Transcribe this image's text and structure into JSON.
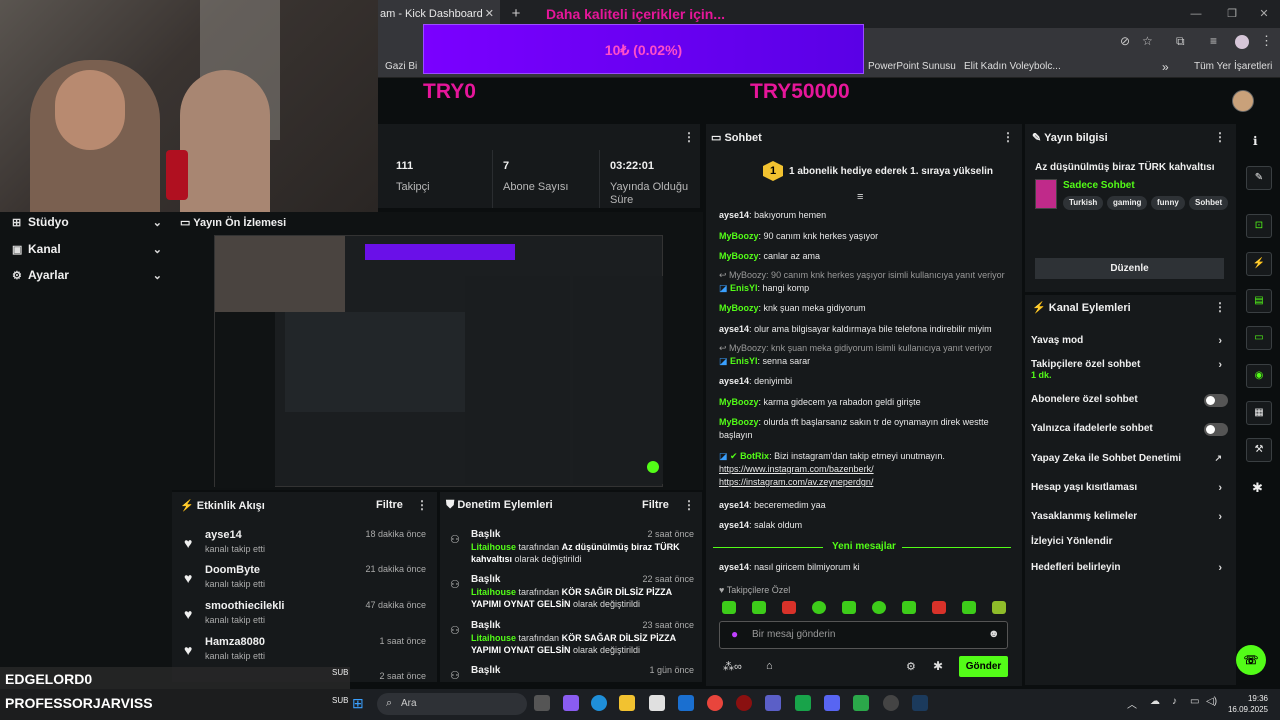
{
  "browser": {
    "tab_title": "am - Kick Dashboard",
    "tab_close": "✕",
    "new_tab": "+",
    "bookmarks": [
      "Gazi Bi",
      "PowerPoint Sunusu",
      "Elit Kadın Voleybolc...",
      "Tüm Yer İşaretleri"
    ]
  },
  "overlay": {
    "title": "Daha kaliteli içerikler için...",
    "bar_text": "10₺ (0.02%)",
    "progress_percent": 0.02,
    "left_label": "TRY0",
    "right_label": "TRY50000"
  },
  "nav": {
    "items": [
      {
        "label": "Stüdyo",
        "icon": "studio-icon"
      },
      {
        "label": "Kanal",
        "icon": "channel-icon"
      },
      {
        "label": "Ayarlar",
        "icon": "gear-icon"
      }
    ]
  },
  "stats": {
    "items": [
      {
        "value": "111",
        "label": "Takipçi"
      },
      {
        "value": "7",
        "label": "Abone Sayısı"
      },
      {
        "value": "03:22:01",
        "label": "Yayında Olduğu Süre"
      }
    ]
  },
  "preview": {
    "title": "Yayın Ön İzlemesi"
  },
  "activity": {
    "title": "Etkinlik Akışı",
    "filter": "Filtre",
    "items": [
      {
        "name": "ayse14",
        "desc": "kanalı takip etti",
        "time": "18 dakika önce"
      },
      {
        "name": "DoomByte",
        "desc": "kanalı takip etti",
        "time": "21 dakika önce"
      },
      {
        "name": "smoothiecilekli",
        "desc": "kanalı takip etti",
        "time": "47 dakika önce"
      },
      {
        "name": "Hamza8080",
        "desc": "kanalı takip etti",
        "time": "1 saat önce"
      },
      {
        "name": "",
        "desc": "",
        "time": "2 saat önce"
      }
    ]
  },
  "moderation": {
    "title": "Denetim Eylemleri",
    "filter": "Filtre",
    "items": [
      {
        "title": "Başlık",
        "time": "2 saat önce",
        "user": "Litaihouse",
        "mid": "tarafından",
        "value": "Az düşünülmüş biraz TÜRK kahvaltısı",
        "tail": "olarak değiştirildi"
      },
      {
        "title": "Başlık",
        "time": "22 saat önce",
        "user": "Litaihouse",
        "mid": "tarafından",
        "value": "KÖR SAĞIR DİLSİZ PİZZA YAPIMI OYNAT GELSİN",
        "tail": "olarak değiştirildi"
      },
      {
        "title": "Başlık",
        "time": "23 saat önce",
        "user": "Litaihouse",
        "mid": "tarafından",
        "value": "KÖR SAĞAR DİLSİZ PİZZA YAPIMI OYNAT GELSİN",
        "tail": "olarak değiştirildi"
      },
      {
        "title": "Başlık",
        "time": "1 gün önce",
        "user": "",
        "mid": "",
        "value": "",
        "tail": ""
      }
    ]
  },
  "chat": {
    "title": "Sohbet",
    "pinned": "1 abonelik hediye ederek 1. sıraya yükselin",
    "pinned_badge": "1",
    "messages": [
      {
        "user": "ayse14",
        "text": "bakıyorum hemen"
      },
      {
        "user": "MyBoozy",
        "text": "90 canım knk herkes yaşıyor"
      },
      {
        "user": "MyBoozy",
        "text": "canlar az ama"
      },
      {
        "reply": "MyBoozy: 90 canım knk herkes yaşıyor isimli kullanıcıya yanıt veriyor",
        "user": "EnisYl",
        "text": "hangi komp"
      },
      {
        "user": "MyBoozy",
        "text": "knk şuan meka gidiyorum"
      },
      {
        "user": "ayse14",
        "text": "olur ama bilgisayar kaldırmaya bile telefona indirebilir miyim"
      },
      {
        "reply": "MyBoozy: knk şuan meka gidiyorum isimli kullanıcıya yanıt veriyor",
        "user": "EnisYl",
        "text": "senna sarar"
      },
      {
        "user": "ayse14",
        "text": "deniyimbi"
      },
      {
        "user": "MyBoozy",
        "text": "karma gidecem ya rabadon geldi girişte"
      },
      {
        "user": "MyBoozy",
        "text": "olurda tft başlarsanız sakın tr de oynamayın direk westte başlayın"
      },
      {
        "user": "BotRix",
        "text": "Bizi instagram'dan takip etmeyi unutmayın.",
        "link1": "https://www.instagram.com/bazenberk/",
        "link2": "https://instagram.com/av.zeyneperdgn/"
      },
      {
        "user": "ayse14",
        "text": "beceremedim yaa"
      },
      {
        "user": "ayse14",
        "text": "salak oldum"
      },
      {
        "user": "ayse14",
        "text": "nasıl giricem bilmiyorum ki"
      }
    ],
    "new_messages": "Yeni mesajlar",
    "followers_only": "Takipçilere Özel",
    "input_placeholder": "Bir mesaj gönderin",
    "send": "Gönder"
  },
  "info": {
    "title": "Yayın bilgisi",
    "stream_title": "Az düşünülmüş biraz TÜRK kahvaltısı",
    "category": "Sadece Sohbet",
    "tags": [
      "Turkish",
      "gaming",
      "funny",
      "Sohbet"
    ],
    "edit": "Düzenle"
  },
  "actions": {
    "title": "Kanal Eylemleri",
    "items": [
      {
        "label": "Yavaş mod",
        "control": "chevron"
      },
      {
        "label": "Takipçilere özel sohbet",
        "sub": "1 dk.",
        "control": "chevron"
      },
      {
        "label": "Abonelere özel sohbet",
        "control": "toggle"
      },
      {
        "label": "Yalnızca ifadelerle sohbet",
        "control": "toggle"
      },
      {
        "label": "Yapay Zeka ile Sohbet Denetimi",
        "control": "external"
      },
      {
        "label": "Hesap yaşı kısıtlaması",
        "control": "chevron"
      },
      {
        "label": "Yasaklanmış kelimeler",
        "control": "chevron"
      },
      {
        "label": "İzleyici Yönlendir",
        "control": "none"
      },
      {
        "label": "Hedefleri belirleyin",
        "control": "chevron"
      }
    ]
  },
  "overlay_bottom": {
    "name1": "EDGELORD0",
    "name2": "PROFESSORJARVISS",
    "sub1": "SUB",
    "sub2": "SUB"
  },
  "taskbar": {
    "search": "Ara",
    "time": "19:36",
    "date": "16.09.2025"
  },
  "colors": {
    "accent": "#53fc18",
    "overlay_pink": "#e6169a",
    "overlay_purple": "#7a00ff"
  }
}
